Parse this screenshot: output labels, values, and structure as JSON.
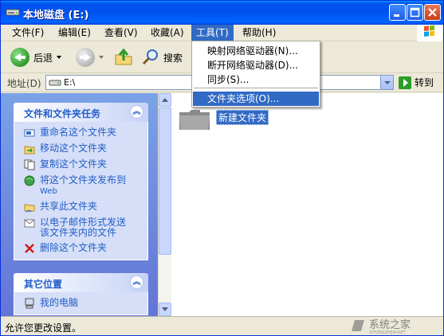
{
  "window": {
    "title": "本地磁盘 (E:)"
  },
  "menu": [
    {
      "label": "文件(F)"
    },
    {
      "label": "编辑(E)"
    },
    {
      "label": "查看(V)"
    },
    {
      "label": "收藏(A)"
    },
    {
      "label": "工具(T)"
    },
    {
      "label": "帮助(H)"
    }
  ],
  "toolbar": {
    "back_label": "后退",
    "search_label": "搜索"
  },
  "address": {
    "label": "地址(D)",
    "value": "E:\\",
    "go_label": "转到"
  },
  "tools_menu": {
    "items": [
      {
        "label": "映射网络驱动器(N)..."
      },
      {
        "label": "断开网络驱动器(D)..."
      },
      {
        "label": "同步(S)..."
      },
      {
        "label": "文件夹选项(O)..."
      }
    ]
  },
  "left_pane": {
    "tasks_title": "文件和文件夹任务",
    "tasks": [
      {
        "label": "重命名这个文件夹"
      },
      {
        "label": "移动这个文件夹"
      },
      {
        "label": "复制这个文件夹"
      },
      {
        "label": "将这个文件夹发布到",
        "label2": "Web"
      },
      {
        "label": "共享此文件夹"
      },
      {
        "label": "以电子邮件形式发送",
        "label2": "该文件夹内的文件"
      },
      {
        "label": "删除这个文件夹"
      }
    ],
    "places_title": "其它位置",
    "places": [
      {
        "label": "我的电脑"
      }
    ]
  },
  "content": {
    "folder_name": "新建文件夹"
  },
  "statusbar": {
    "text": "允许您更改设置。"
  },
  "watermark": {
    "text": "系统之家",
    "sub": "XITONGZHIJIA.NET"
  },
  "colors": {
    "title_blue": "#0053ee",
    "selection": "#316ac5",
    "task_blue": "#215dc6"
  }
}
